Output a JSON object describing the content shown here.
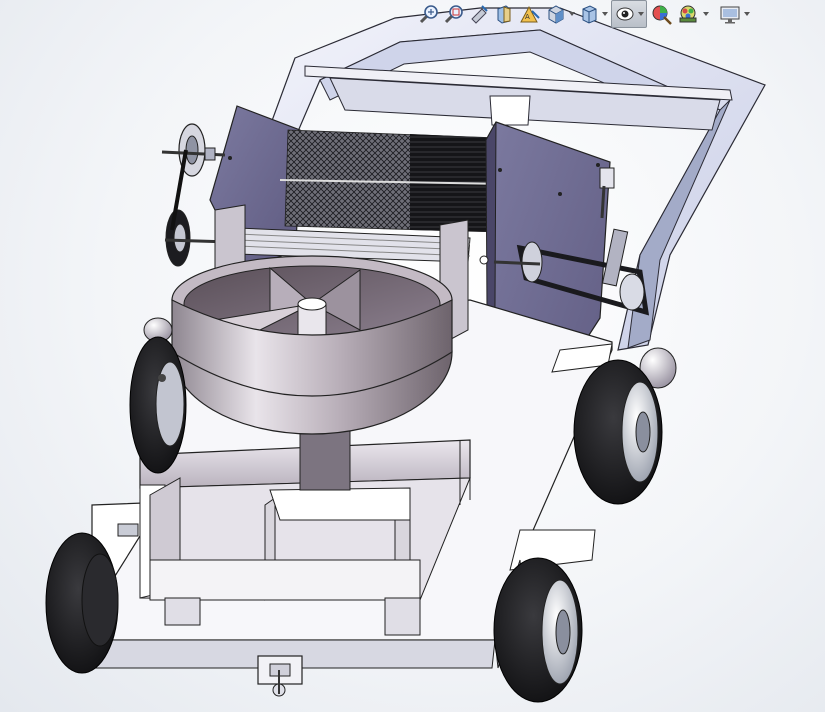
{
  "window": {
    "view_type": "3d-cad-graphics-area"
  },
  "heads_up_toolbar": {
    "buttons": [
      {
        "id": "zoom-to-fit",
        "icon": "zoom-to-fit-icon",
        "has_dropdown": false
      },
      {
        "id": "zoom-to-area",
        "icon": "zoom-to-area-icon",
        "has_dropdown": false
      },
      {
        "id": "previous-view",
        "icon": "previous-view-icon",
        "has_dropdown": false
      },
      {
        "id": "section-view",
        "icon": "section-view-icon",
        "has_dropdown": false
      },
      {
        "id": "dynamic-annotation",
        "icon": "dynamic-annotation-icon",
        "has_dropdown": false
      },
      {
        "id": "view-orientation",
        "icon": "view-orientation-icon",
        "has_dropdown": true
      },
      {
        "id": "display-style",
        "icon": "display-style-icon",
        "has_dropdown": true
      },
      {
        "id": "hide-show-items",
        "icon": "hide-show-items-icon",
        "has_dropdown": true,
        "active": true
      },
      {
        "id": "edit-appearance",
        "icon": "edit-appearance-icon",
        "has_dropdown": false
      },
      {
        "id": "apply-scene",
        "icon": "apply-scene-icon",
        "has_dropdown": true
      },
      {
        "id": "view-settings",
        "icon": "view-settings-icon",
        "has_dropdown": true
      }
    ]
  },
  "colors": {
    "frame": "#e6e9f6",
    "frame_shadow": "#aab1cc",
    "side_plate": "#6e6a90",
    "bin": "#a79ea8",
    "base": "#f4f4f8",
    "tire": "#1e1e20",
    "brush": "#3a3a40",
    "active_button": "#b9bfc8"
  }
}
